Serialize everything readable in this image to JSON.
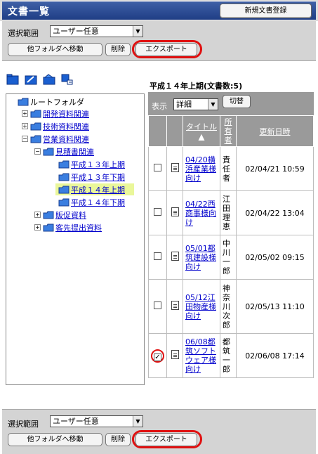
{
  "header": {
    "title": "文書一覧",
    "new_doc_label": "新規文書登録"
  },
  "controls_top": {
    "scope_label": "選択範囲",
    "scope_value": "ユーザー任意",
    "move_label": "他フォルダへ移動",
    "delete_label": "削除",
    "export_label": "エクスポート"
  },
  "controls_bottom": {
    "scope_label": "選択範囲",
    "scope_value": "ユーザー任意",
    "move_label": "他フォルダへ移動",
    "delete_label": "削除",
    "export_label": "エクスポート"
  },
  "tree": {
    "root": "ルートフォルダ",
    "items": [
      {
        "label": "開発資料関連",
        "expander": "+"
      },
      {
        "label": "技術資料関連",
        "expander": "+"
      },
      {
        "label": "営業資料関連",
        "expander": "−"
      },
      {
        "label": "見積書関連",
        "expander": "−"
      },
      {
        "label": "平成１３年上期"
      },
      {
        "label": "平成１３年下期"
      },
      {
        "label": "平成１４年上期",
        "selected": true
      },
      {
        "label": "平成１４年下期"
      },
      {
        "label": "販促資料",
        "expander": "+"
      },
      {
        "label": "客先提出資料",
        "expander": "+"
      }
    ]
  },
  "docs": {
    "folder_title": "平成１４年上期(文書数:5)",
    "view_label": "表示",
    "view_value": "詳細",
    "switch_label": "切替",
    "col_title": "タイトル",
    "col_sort_arrow": "▲",
    "col_owner": "所有者",
    "col_updated": "更新日時",
    "rows": [
      {
        "title": "04/20横浜産業様向け",
        "owner": "責任者",
        "updated": "02/04/21 10:59",
        "checked": false
      },
      {
        "title": "04/22西商事様向け",
        "owner": "江田理恵",
        "updated": "02/04/22 13:04",
        "checked": false
      },
      {
        "title": "05/01都筑建設様向け",
        "owner": "中川一郎",
        "updated": "02/05/02 09:15",
        "checked": false
      },
      {
        "title": "05/12江田物産様向け",
        "owner": "神奈川次郎",
        "updated": "02/05/13 11:10",
        "checked": false
      },
      {
        "title": "06/08都筑ソフトウェア様向け",
        "owner": "都筑一郎",
        "updated": "02/06/08 17:14",
        "checked": true
      }
    ]
  },
  "colors": {
    "title_bar": "#2e4f98",
    "panel_gray": "#d4d4d4",
    "highlight": "#e01010",
    "selected_row": "#eaf79a",
    "link": "#0000cc"
  }
}
